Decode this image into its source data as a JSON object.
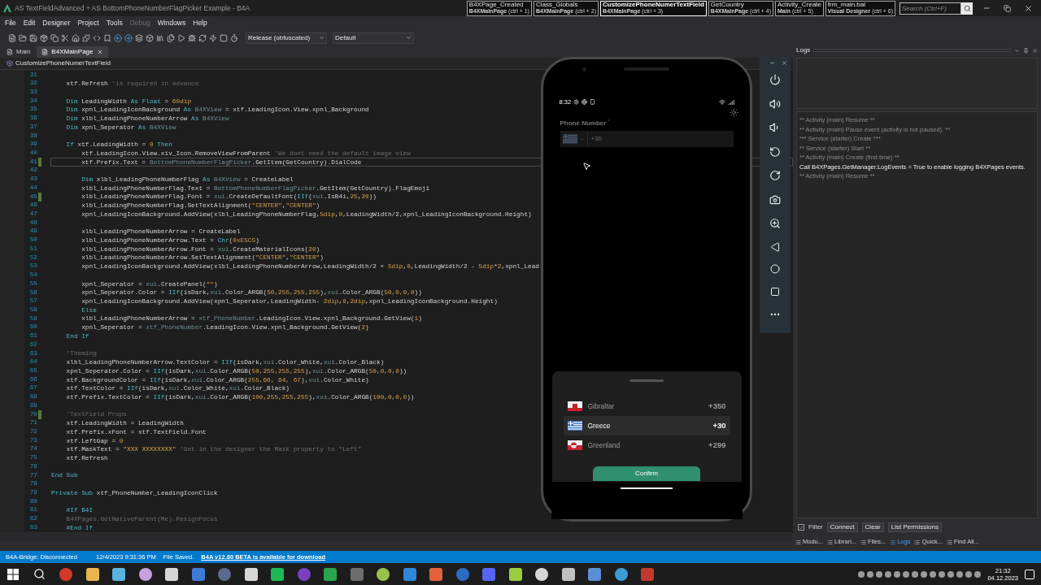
{
  "window": {
    "title": "AS TextFieldAdvanced + AS BottomPhoneNumberFlagPicker Example - B4A"
  },
  "quick_nav": [
    {
      "title": "B4XPage_Created",
      "module": "B4XMainPage",
      "shortcut": "(ctrl + 1)",
      "selected": false
    },
    {
      "title": "Class_Globals",
      "module": "B4XMainPage",
      "shortcut": "(ctrl + 2)",
      "selected": false
    },
    {
      "title": "CustomizePhoneNumerTextField",
      "module": "B4XMainPage",
      "shortcut": "(ctrl + 3)",
      "selected": true
    },
    {
      "title": "GetCountry",
      "module": "B4XMainPage",
      "shortcut": "(ctrl + 4)",
      "selected": false
    },
    {
      "title": "Activity_Create",
      "module": "Main",
      "shortcut": "(ctrl + 5)",
      "selected": false
    },
    {
      "title": "frm_main.bal",
      "module": "Visual Designer",
      "shortcut": "(ctrl + 6)",
      "selected": false
    }
  ],
  "search": {
    "placeholder": "Search (Ctrl+F)"
  },
  "menu": [
    {
      "label": "File",
      "disabled": false
    },
    {
      "label": "Edit",
      "disabled": false
    },
    {
      "label": "Designer",
      "disabled": false
    },
    {
      "label": "Project",
      "disabled": false
    },
    {
      "label": "Tools",
      "disabled": false
    },
    {
      "label": "Debug",
      "disabled": true
    },
    {
      "label": "Windows",
      "disabled": false
    },
    {
      "label": "Help",
      "disabled": false
    }
  ],
  "toolbar": {
    "build_mode": "Release (obfuscated)",
    "configuration": "Default"
  },
  "tabs": [
    {
      "label": "Main",
      "selected": false
    },
    {
      "label": "B4XMainPage",
      "selected": true
    }
  ],
  "breadcrumb": "CustomizePhoneNumerTextField",
  "editor": {
    "lines": [
      {
        "number": "31",
        "modified": false,
        "current": false
      },
      {
        "number": "32",
        "modified": false,
        "current": false,
        "segments": [
          {
            "text": "    xtf.Refresh ",
            "kind": "plain"
          },
          {
            "text": "'is required in advance",
            "kind": "comment"
          }
        ]
      },
      {
        "number": "33",
        "modified": false,
        "current": false
      },
      {
        "number": "34",
        "modified": false,
        "current": false,
        "segments": [
          {
            "text": "    Dim",
            "kind": "keyword"
          },
          {
            "text": " LeadingWidth ",
            "kind": "plain"
          },
          {
            "text": "As Float",
            "kind": "keyword"
          },
          {
            "text": " = ",
            "kind": "plain"
          },
          {
            "text": "60dip",
            "kind": "literal"
          }
        ]
      },
      {
        "number": "35",
        "modified": false,
        "current": false,
        "segments": [
          {
            "text": "    Dim",
            "kind": "keyword"
          },
          {
            "text": " xpnl_LeadingIconBackground ",
            "kind": "plain"
          },
          {
            "text": "As",
            "kind": "keyword"
          },
          {
            "text": " B4XView",
            "kind": "type"
          },
          {
            "text": " = xtf.LeadingIcon.View.xpnl_Background",
            "kind": "plain"
          }
        ]
      },
      {
        "number": "36",
        "modified": false,
        "current": false,
        "segments": [
          {
            "text": "    Dim",
            "kind": "keyword"
          },
          {
            "text": " xlbl_LeadingPhoneNumberArrow ",
            "kind": "plain"
          },
          {
            "text": "As",
            "kind": "keyword"
          },
          {
            "text": " B4XView",
            "kind": "type"
          }
        ]
      },
      {
        "number": "37",
        "modified": false,
        "current": false,
        "segments": [
          {
            "text": "    Dim",
            "kind": "keyword"
          },
          {
            "text": " xpnl_Seperator ",
            "kind": "plain"
          },
          {
            "text": "As",
            "kind": "keyword"
          },
          {
            "text": " B4XView",
            "kind": "type"
          }
        ]
      },
      {
        "number": "38",
        "modified": false,
        "current": false
      },
      {
        "number": "39",
        "modified": false,
        "current": false,
        "segments": [
          {
            "text": "    If",
            "kind": "keyword"
          },
          {
            "text": " xtf.LeadingWidth = ",
            "kind": "plain"
          },
          {
            "text": "0",
            "kind": "literal"
          },
          {
            "text": " Then",
            "kind": "keyword"
          }
        ]
      },
      {
        "number": "40",
        "modified": false,
        "current": false,
        "segments": [
          {
            "text": "        xtf.LeadingIcon.View.xiv_Icon.RemoveViewFromParent ",
            "kind": "plain"
          },
          {
            "text": "'We dont need the default image view",
            "kind": "comment"
          }
        ]
      },
      {
        "number": "41",
        "modified": true,
        "current": true,
        "segments": [
          {
            "text": "        xtf.Prefix.Text = ",
            "kind": "plain"
          },
          {
            "text": "BottomPhoneNumberFlagPicker",
            "kind": "type"
          },
          {
            "text": ".GetItem(GetCountry).DialCode",
            "kind": "plain"
          }
        ]
      },
      {
        "number": "42",
        "modified": false,
        "current": false
      },
      {
        "number": "43",
        "modified": false,
        "current": false,
        "segments": [
          {
            "text": "        Dim",
            "kind": "keyword"
          },
          {
            "text": " xlbl_LeadingPhoneNumberFlag ",
            "kind": "plain"
          },
          {
            "text": "As",
            "kind": "keyword"
          },
          {
            "text": " B4XView",
            "kind": "type"
          },
          {
            "text": " = CreateLabel",
            "kind": "plain"
          }
        ]
      },
      {
        "number": "44",
        "modified": false,
        "current": false,
        "segments": [
          {
            "text": "        xlbl_LeadingPhoneNumberFlag.Text = ",
            "kind": "plain"
          },
          {
            "text": "BottomPhoneNumberFlagPicker",
            "kind": "type"
          },
          {
            "text": ".GetItem(GetCountry).FlagEmoji",
            "kind": "plain"
          }
        ]
      },
      {
        "number": "45",
        "modified": true,
        "current": false,
        "segments": [
          {
            "text": "        xlbl_LeadingPhoneNumberFlag.Font = ",
            "kind": "plain"
          },
          {
            "text": "xui",
            "kind": "type"
          },
          {
            "text": ".CreateDefaultFont(",
            "kind": "plain"
          },
          {
            "text": "IIf",
            "kind": "keyword"
          },
          {
            "text": "(",
            "kind": "plain"
          },
          {
            "text": "xui",
            "kind": "type"
          },
          {
            "text": ".IsB4i,",
            "kind": "plain"
          },
          {
            "text": "25",
            "kind": "literal"
          },
          {
            "text": ",",
            "kind": "plain"
          },
          {
            "text": "20",
            "kind": "literal"
          },
          {
            "text": "))",
            "kind": "plain"
          }
        ]
      },
      {
        "number": "46",
        "modified": false,
        "current": false,
        "segments": [
          {
            "text": "        xlbl_LeadingPhoneNumberFlag.SetTextAlignment(",
            "kind": "plain"
          },
          {
            "text": "\"CENTER\"",
            "kind": "literal"
          },
          {
            "text": ",",
            "kind": "plain"
          },
          {
            "text": "\"CENTER\"",
            "kind": "literal"
          },
          {
            "text": ")",
            "kind": "plain"
          }
        ]
      },
      {
        "number": "47",
        "modified": false,
        "current": false,
        "segments": [
          {
            "text": "        xpnl_LeadingIconBackground.AddView(xlbl_LeadingPhoneNumberFlag,",
            "kind": "plain"
          },
          {
            "text": "5dip",
            "kind": "literal"
          },
          {
            "text": ",",
            "kind": "plain"
          },
          {
            "text": "0",
            "kind": "literal"
          },
          {
            "text": ",LeadingWidth/2,xpnl_LeadingIconBackground.Height)",
            "kind": "plain"
          }
        ]
      },
      {
        "number": "48",
        "modified": false,
        "current": false
      },
      {
        "number": "49",
        "modified": false,
        "current": false,
        "segments": [
          {
            "text": "        xlbl_LeadingPhoneNumberArrow = CreateLabel",
            "kind": "plain"
          }
        ]
      },
      {
        "number": "50",
        "modified": false,
        "current": false,
        "segments": [
          {
            "text": "        xlbl_LeadingPhoneNumberArrow.Text = ",
            "kind": "plain"
          },
          {
            "text": "Chr",
            "kind": "keyword"
          },
          {
            "text": "(",
            "kind": "plain"
          },
          {
            "text": "0xE5C5",
            "kind": "literal"
          },
          {
            "text": ")",
            "kind": "plain"
          }
        ]
      },
      {
        "number": "51",
        "modified": false,
        "current": false,
        "segments": [
          {
            "text": "        xlbl_LeadingPhoneNumberArrow.Font = ",
            "kind": "plain"
          },
          {
            "text": "xui",
            "kind": "type"
          },
          {
            "text": ".CreateMaterialIcons(",
            "kind": "plain"
          },
          {
            "text": "20",
            "kind": "literal"
          },
          {
            "text": ")",
            "kind": "plain"
          }
        ]
      },
      {
        "number": "52",
        "modified": false,
        "current": false,
        "segments": [
          {
            "text": "        xlbl_LeadingPhoneNumberArrow.SetTextAlignment(",
            "kind": "plain"
          },
          {
            "text": "\"CENTER\"",
            "kind": "literal"
          },
          {
            "text": ",",
            "kind": "plain"
          },
          {
            "text": "\"CENTER\"",
            "kind": "literal"
          },
          {
            "text": ")",
            "kind": "plain"
          }
        ]
      },
      {
        "number": "53",
        "modified": false,
        "current": false,
        "segments": [
          {
            "text": "        xpnl_LeadingIconBackground.AddView(xlbl_LeadingPhoneNumberArrow,LeadingWidth/2 + ",
            "kind": "plain"
          },
          {
            "text": "5dip",
            "kind": "literal"
          },
          {
            "text": ",",
            "kind": "plain"
          },
          {
            "text": "0",
            "kind": "literal"
          },
          {
            "text": ",LeadingWidth/2 - ",
            "kind": "plain"
          },
          {
            "text": "5dip",
            "kind": "literal"
          },
          {
            "text": "*",
            "kind": "plain"
          },
          {
            "text": "2",
            "kind": "literal"
          },
          {
            "text": ",xpnl_Lead",
            "kind": "plain"
          }
        ]
      },
      {
        "number": "54",
        "modified": false,
        "current": false
      },
      {
        "number": "55",
        "modified": false,
        "current": false,
        "segments": [
          {
            "text": "        xpnl_Seperator = ",
            "kind": "plain"
          },
          {
            "text": "xui",
            "kind": "type"
          },
          {
            "text": ".CreatePanel(",
            "kind": "plain"
          },
          {
            "text": "\"\"",
            "kind": "literal"
          },
          {
            "text": ")",
            "kind": "plain"
          }
        ]
      },
      {
        "number": "56",
        "modified": false,
        "current": false,
        "segments": [
          {
            "text": "        xpnl_Seperator.Color = ",
            "kind": "plain"
          },
          {
            "text": "IIf",
            "kind": "keyword"
          },
          {
            "text": "(isDark,",
            "kind": "plain"
          },
          {
            "text": "xui",
            "kind": "type"
          },
          {
            "text": ".Color_ARGB(",
            "kind": "plain"
          },
          {
            "text": "50,255,255,255",
            "kind": "literal"
          },
          {
            "text": "),",
            "kind": "plain"
          },
          {
            "text": "xui",
            "kind": "type"
          },
          {
            "text": ".Color_ARGB(",
            "kind": "plain"
          },
          {
            "text": "50,0,0,0",
            "kind": "literal"
          },
          {
            "text": "))",
            "kind": "plain"
          }
        ]
      },
      {
        "number": "57",
        "modified": false,
        "current": false,
        "segments": [
          {
            "text": "        xpnl_LeadingIconBackground.AddView(xpnl_Seperator,LeadingWidth- ",
            "kind": "plain"
          },
          {
            "text": "2dip",
            "kind": "literal"
          },
          {
            "text": ",",
            "kind": "plain"
          },
          {
            "text": "0",
            "kind": "literal"
          },
          {
            "text": ",",
            "kind": "plain"
          },
          {
            "text": "2dip",
            "kind": "literal"
          },
          {
            "text": ",xpnl_LeadingIconBackground.Height)",
            "kind": "plain"
          }
        ]
      },
      {
        "number": "58",
        "modified": false,
        "current": false,
        "segments": [
          {
            "text": "        Else",
            "kind": "keyword"
          }
        ]
      },
      {
        "number": "59",
        "modified": false,
        "current": false,
        "segments": [
          {
            "text": "        xlbl_LeadingPhoneNumberArrow = ",
            "kind": "plain"
          },
          {
            "text": "xtf_PhoneNumber",
            "kind": "type"
          },
          {
            "text": ".LeadingIcon.View.xpnl_Background.GetView(",
            "kind": "plain"
          },
          {
            "text": "1",
            "kind": "literal"
          },
          {
            "text": ")",
            "kind": "plain"
          }
        ]
      },
      {
        "number": "60",
        "modified": false,
        "current": false,
        "segments": [
          {
            "text": "        xpnl_Seperator = ",
            "kind": "plain"
          },
          {
            "text": "xtf_PhoneNumber",
            "kind": "type"
          },
          {
            "text": ".LeadingIcon.View.xpnl_Background.GetView(",
            "kind": "plain"
          },
          {
            "text": "2",
            "kind": "literal"
          },
          {
            "text": ")",
            "kind": "plain"
          }
        ]
      },
      {
        "number": "61",
        "modified": false,
        "current": false,
        "segments": [
          {
            "text": "    End If",
            "kind": "keyword"
          }
        ]
      },
      {
        "number": "62",
        "modified": false,
        "current": false
      },
      {
        "number": "63",
        "modified": false,
        "current": false,
        "segments": [
          {
            "text": "    'Theming",
            "kind": "comment"
          }
        ]
      },
      {
        "number": "64",
        "modified": false,
        "current": false,
        "segments": [
          {
            "text": "    xlbl_LeadingPhoneNumberArrow.TextColor = ",
            "kind": "plain"
          },
          {
            "text": "IIf",
            "kind": "keyword"
          },
          {
            "text": "(isDark,",
            "kind": "plain"
          },
          {
            "text": "xui",
            "kind": "type"
          },
          {
            "text": ".Color_White,",
            "kind": "plain"
          },
          {
            "text": "xui",
            "kind": "type"
          },
          {
            "text": ".Color_Black)",
            "kind": "plain"
          }
        ]
      },
      {
        "number": "65",
        "modified": false,
        "current": false,
        "segments": [
          {
            "text": "    xpnl_Seperator.Color = ",
            "kind": "plain"
          },
          {
            "text": "IIf",
            "kind": "keyword"
          },
          {
            "text": "(isDark,",
            "kind": "plain"
          },
          {
            "text": "xui",
            "kind": "type"
          },
          {
            "text": ".Color_ARGB(",
            "kind": "plain"
          },
          {
            "text": "50,255,255,255",
            "kind": "literal"
          },
          {
            "text": "),",
            "kind": "plain"
          },
          {
            "text": "xui",
            "kind": "type"
          },
          {
            "text": ".Color_ARGB(",
            "kind": "plain"
          },
          {
            "text": "50,0,0,0",
            "kind": "literal"
          },
          {
            "text": "))",
            "kind": "plain"
          }
        ]
      },
      {
        "number": "66",
        "modified": false,
        "current": false,
        "segments": [
          {
            "text": "    xtf.BackgroundColor = ",
            "kind": "plain"
          },
          {
            "text": "IIf",
            "kind": "keyword"
          },
          {
            "text": "(isDark,",
            "kind": "plain"
          },
          {
            "text": "xui",
            "kind": "type"
          },
          {
            "text": ".Color_ARGB(",
            "kind": "plain"
          },
          {
            "text": "255,60, 64, 67",
            "kind": "literal"
          },
          {
            "text": "),",
            "kind": "plain"
          },
          {
            "text": "xui",
            "kind": "type"
          },
          {
            "text": ".Color_White)",
            "kind": "plain"
          }
        ]
      },
      {
        "number": "67",
        "modified": false,
        "current": false,
        "segments": [
          {
            "text": "    xtf.TextColor = ",
            "kind": "plain"
          },
          {
            "text": "IIf",
            "kind": "keyword"
          },
          {
            "text": "(isDark,",
            "kind": "plain"
          },
          {
            "text": "xui",
            "kind": "type"
          },
          {
            "text": ".Color_White,",
            "kind": "plain"
          },
          {
            "text": "xui",
            "kind": "type"
          },
          {
            "text": ".Color_Black)",
            "kind": "plain"
          }
        ]
      },
      {
        "number": "68",
        "modified": false,
        "current": false,
        "segments": [
          {
            "text": "    xtf.Prefix.TextColor = ",
            "kind": "plain"
          },
          {
            "text": "IIf",
            "kind": "keyword"
          },
          {
            "text": "(isDark,",
            "kind": "plain"
          },
          {
            "text": "xui",
            "kind": "type"
          },
          {
            "text": ".Color_ARGB(",
            "kind": "plain"
          },
          {
            "text": "100,255,255,255",
            "kind": "literal"
          },
          {
            "text": "),",
            "kind": "plain"
          },
          {
            "text": "xui",
            "kind": "type"
          },
          {
            "text": ".Color_ARGB(",
            "kind": "plain"
          },
          {
            "text": "100,0,0,0",
            "kind": "literal"
          },
          {
            "text": "))",
            "kind": "plain"
          }
        ]
      },
      {
        "number": "69",
        "modified": false,
        "current": false
      },
      {
        "number": "70",
        "modified": true,
        "current": false,
        "segments": [
          {
            "text": "    'TextField Props",
            "kind": "comment"
          }
        ]
      },
      {
        "number": "71",
        "modified": false,
        "current": false,
        "segments": [
          {
            "text": "    xtf.LeadingWidth = LeadingWidth",
            "kind": "plain"
          }
        ]
      },
      {
        "number": "72",
        "modified": false,
        "current": false,
        "segments": [
          {
            "text": "    xtf.Prefix.xFont = xtf.TextField.Font",
            "kind": "plain"
          }
        ]
      },
      {
        "number": "73",
        "modified": false,
        "current": false,
        "segments": [
          {
            "text": "    xtf.LeftGap = ",
            "kind": "plain"
          },
          {
            "text": "0",
            "kind": "literal"
          }
        ]
      },
      {
        "number": "74",
        "modified": false,
        "current": false,
        "segments": [
          {
            "text": "    xtf.MaskText = ",
            "kind": "plain"
          },
          {
            "text": "\"XXX XXXXXXXX\"",
            "kind": "literal"
          },
          {
            "text": " 'Set in the designer the Mask property to \"Left\"",
            "kind": "comment"
          }
        ]
      },
      {
        "number": "75",
        "modified": false,
        "current": false,
        "segments": [
          {
            "text": "    xtf.Refresh",
            "kind": "plain"
          }
        ]
      },
      {
        "number": "76",
        "modified": false,
        "current": false
      },
      {
        "number": "77",
        "modified": false,
        "current": false,
        "segments": [
          {
            "text": "End Sub",
            "kind": "keyword"
          }
        ]
      },
      {
        "number": "78",
        "modified": false,
        "current": false
      },
      {
        "number": "79",
        "modified": false,
        "current": false,
        "segments": [
          {
            "text": "Private Sub",
            "kind": "keyword"
          },
          {
            "text": " xtf_PhoneNumber_LeadingIconClick",
            "kind": "plain"
          }
        ]
      },
      {
        "number": "80",
        "modified": false,
        "current": false
      },
      {
        "number": "81",
        "modified": false,
        "current": false,
        "segments": [
          {
            "text": "    #If B4I",
            "kind": "keyword"
          }
        ]
      },
      {
        "number": "82",
        "modified": false,
        "current": false,
        "segments": [
          {
            "text": "    B4XPages.GetNativeParent(Me).ResignFocus",
            "kind": "comment"
          }
        ]
      },
      {
        "number": "83",
        "modified": false,
        "current": false,
        "segments": [
          {
            "text": "    #End If",
            "kind": "keyword"
          }
        ]
      }
    ]
  },
  "phone": {
    "time": "8:32",
    "field_label": "Phone Number",
    "required_mark": "*",
    "prefix": "+30",
    "countries": [
      {
        "name": "Gibraltar",
        "code": "+350",
        "kind": "gibraltar",
        "selected": false
      },
      {
        "name": "Greece",
        "code": "+30",
        "kind": "greece",
        "selected": true
      },
      {
        "name": "Greenland",
        "code": "+299",
        "kind": "greenland",
        "selected": false
      }
    ],
    "confirm": "Confirm"
  },
  "logs": {
    "title": "Logs",
    "entries": [
      {
        "text": "** Activity (main) Resume **",
        "kind": "system"
      },
      {
        "text": "** Activity (main) Pause event (activity is not paused). **",
        "kind": "system"
      },
      {
        "text": "*** Service (starter) Create ***",
        "kind": "system"
      },
      {
        "text": "** Service (starter) Start **",
        "kind": "system"
      },
      {
        "text": "** Activity (main) Create (first time) **",
        "kind": "system"
      },
      {
        "text": "Call B4XPages.GetManager.LogEvents = True to enable logging B4XPages events.",
        "kind": "message"
      },
      {
        "text": "** Activity (main) Resume **",
        "kind": "system"
      }
    ],
    "filter": {
      "label": "Filter",
      "checked": true
    },
    "buttons": [
      "Connect",
      "Clear",
      "List Permissions"
    ]
  },
  "panel_tabs": [
    {
      "label": "Modu...",
      "selected": false
    },
    {
      "label": "Librari...",
      "selected": false
    },
    {
      "label": "Files...",
      "selected": false
    },
    {
      "label": "Logs",
      "selected": true
    },
    {
      "label": "Quick...",
      "selected": false
    },
    {
      "label": "Find All...",
      "selected": false
    }
  ],
  "status_bar": {
    "bridge": "B4A-Bridge: Disconnected",
    "timestamp": "12/4/2023 9:31:36 PM",
    "message": "File Saved.",
    "update_link": "B4A v12.80 BETA is available for download"
  },
  "taskbar": {
    "time": "21:32",
    "date": "04.12.2023"
  }
}
